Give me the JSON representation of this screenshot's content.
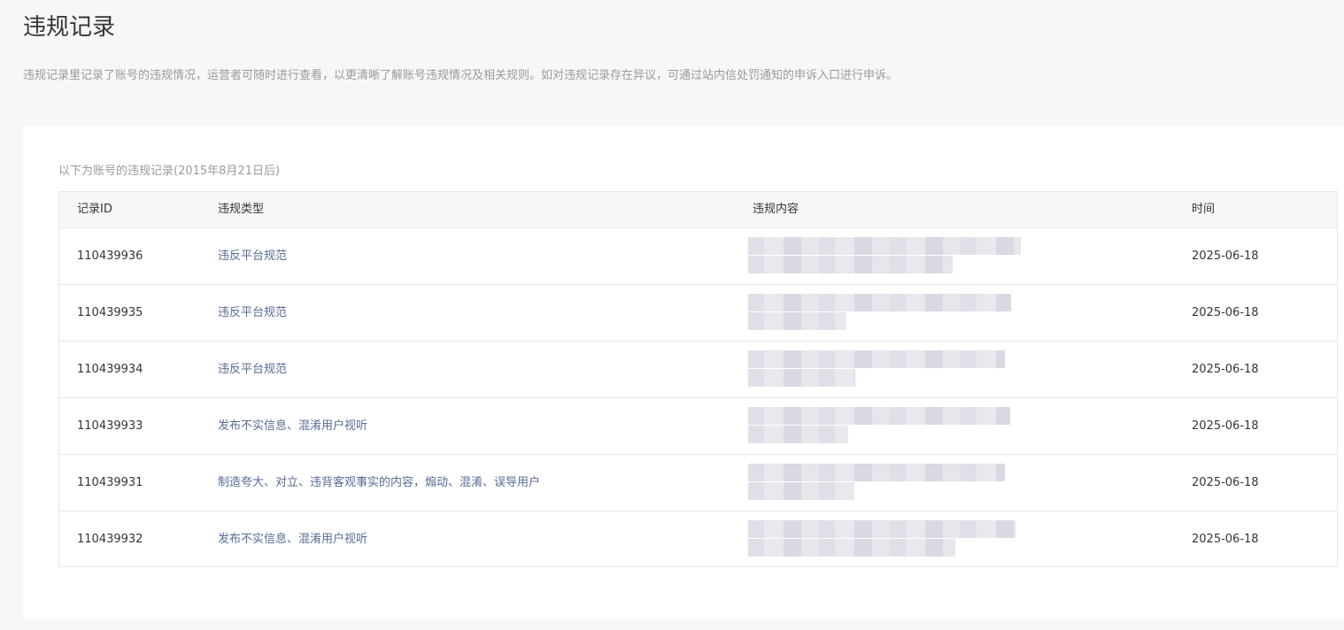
{
  "page": {
    "title": "违规记录",
    "description": "违规记录里记录了账号的违规情况，运营者可随时进行查看，以更清晰了解账号违规情况及相关规则。如对违规记录存在异议，可通过站内信处罚通知的申诉入口进行申诉。"
  },
  "table": {
    "caption": "以下为账号的违规记录(2015年8月21日后)",
    "columns": {
      "id": "记录ID",
      "type": "违规类型",
      "content": "违规内容",
      "time": "时间"
    },
    "rows": [
      {
        "id": "110439936",
        "type": "违反平台规范",
        "time": "2025-06-18",
        "content_blurred": true
      },
      {
        "id": "110439935",
        "type": "违反平台规范",
        "time": "2025-06-18",
        "content_blurred": true
      },
      {
        "id": "110439934",
        "type": "违反平台规范",
        "time": "2025-06-18",
        "content_blurred": true
      },
      {
        "id": "110439933",
        "type": "发布不实信息、混淆用户视听",
        "time": "2025-06-18",
        "content_blurred": true
      },
      {
        "id": "110439931",
        "type": "制造夸大、对立、违背客观事实的内容，煽动、混淆、误导用户",
        "time": "2025-06-18",
        "content_blurred": true
      },
      {
        "id": "110439932",
        "type": "发布不实信息、混淆用户视听",
        "time": "2025-06-18",
        "content_blurred": true
      }
    ]
  },
  "colors": {
    "background": "#f6f7f9",
    "card": "#ffffff",
    "text": "#353535",
    "muted": "#9a9a9a",
    "link": "#576b95",
    "border": "#e7e7eb"
  }
}
